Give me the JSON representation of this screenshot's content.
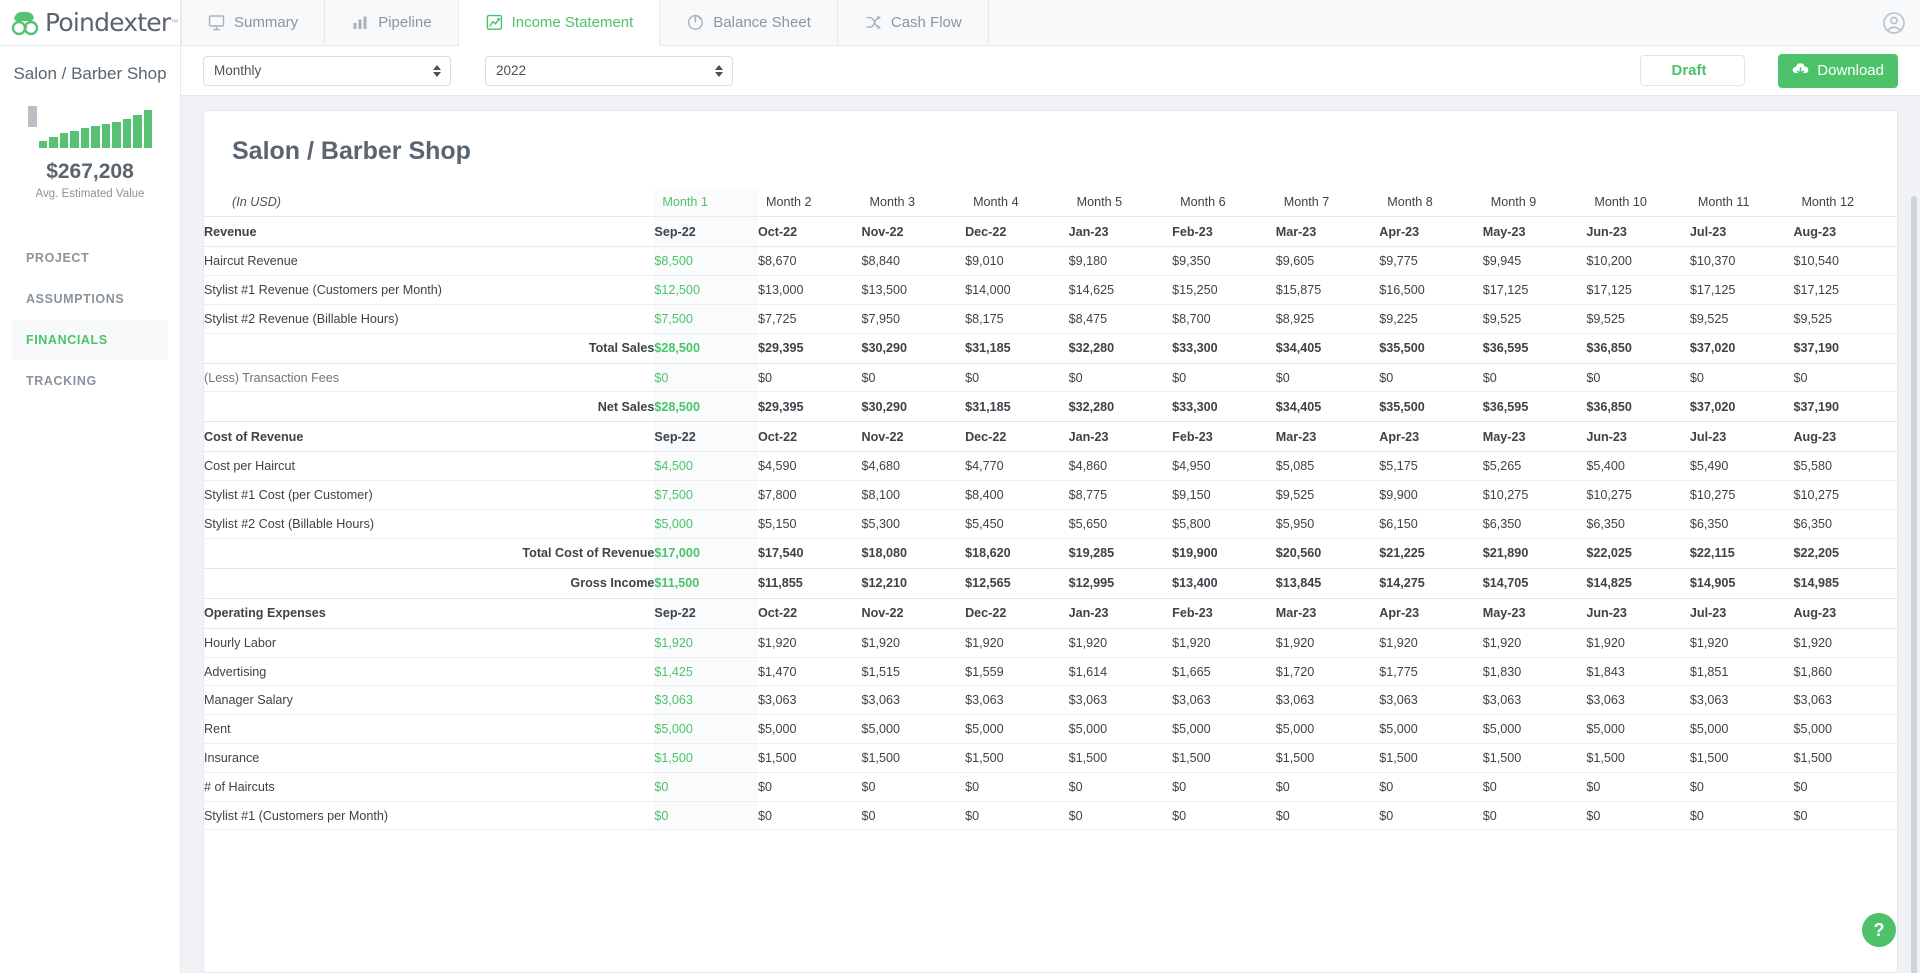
{
  "brand": {
    "name": "Poindexter",
    "tm": "™"
  },
  "sidebar": {
    "project_name": "Salon / Barber Shop",
    "value": "$267,208",
    "value_caption": "Avg. Estimated Value",
    "sparkline": [
      -18,
      6,
      10,
      13,
      15,
      17,
      19,
      21,
      23,
      25,
      29,
      33
    ],
    "items": [
      {
        "label": "PROJECT",
        "active": false
      },
      {
        "label": "ASSUMPTIONS",
        "active": false
      },
      {
        "label": "FINANCIALS",
        "active": true
      },
      {
        "label": "TRACKING",
        "active": false
      }
    ]
  },
  "tabs": [
    {
      "label": "Summary",
      "icon": "presentation-icon",
      "active": false
    },
    {
      "label": "Pipeline",
      "icon": "bar-chart-icon",
      "active": false
    },
    {
      "label": "Income Statement",
      "icon": "line-chart-icon",
      "active": true
    },
    {
      "label": "Balance Sheet",
      "icon": "pie-chart-icon",
      "active": false
    },
    {
      "label": "Cash Flow",
      "icon": "shuffle-icon",
      "active": false
    }
  ],
  "toolbar": {
    "period": "Monthly",
    "year": "2022",
    "status": "Draft",
    "download": "Download"
  },
  "report": {
    "title": "Salon / Barber Shop",
    "units_label": "(In USD)",
    "columns": [
      "Month 1",
      "Month 2",
      "Month 3",
      "Month 4",
      "Month 5",
      "Month 6",
      "Month 7",
      "Month 8",
      "Month 9",
      "Month 10",
      "Month 11",
      "Month 12"
    ],
    "dates": [
      "Sep-22",
      "Oct-22",
      "Nov-22",
      "Dec-22",
      "Jan-23",
      "Feb-23",
      "Mar-23",
      "Apr-23",
      "May-23",
      "Jun-23",
      "Jul-23",
      "Aug-23"
    ],
    "rows": [
      {
        "kind": "section",
        "label": "Revenue"
      },
      {
        "kind": "item",
        "label": "Haircut Revenue",
        "values": [
          "$8,500",
          "$8,670",
          "$8,840",
          "$9,010",
          "$9,180",
          "$9,350",
          "$9,605",
          "$9,775",
          "$9,945",
          "$10,200",
          "$10,370",
          "$10,540"
        ]
      },
      {
        "kind": "item",
        "label": "Stylist #1 Revenue (Customers per Month)",
        "values": [
          "$12,500",
          "$13,000",
          "$13,500",
          "$14,000",
          "$14,625",
          "$15,250",
          "$15,875",
          "$16,500",
          "$17,125",
          "$17,125",
          "$17,125",
          "$17,125"
        ]
      },
      {
        "kind": "item",
        "label": "Stylist #2 Revenue (Billable Hours)",
        "values": [
          "$7,500",
          "$7,725",
          "$7,950",
          "$8,175",
          "$8,475",
          "$8,700",
          "$8,925",
          "$9,225",
          "$9,525",
          "$9,525",
          "$9,525",
          "$9,525"
        ]
      },
      {
        "kind": "total",
        "label": "Total Sales",
        "values": [
          "$28,500",
          "$29,395",
          "$30,290",
          "$31,185",
          "$32,280",
          "$33,300",
          "$34,405",
          "$35,500",
          "$36,595",
          "$36,850",
          "$37,020",
          "$37,190"
        ]
      },
      {
        "kind": "item",
        "muted": true,
        "label": "(Less) Transaction Fees",
        "values": [
          "$0",
          "$0",
          "$0",
          "$0",
          "$0",
          "$0",
          "$0",
          "$0",
          "$0",
          "$0",
          "$0",
          "$0"
        ]
      },
      {
        "kind": "total",
        "label": "Net Sales",
        "values": [
          "$28,500",
          "$29,395",
          "$30,290",
          "$31,185",
          "$32,280",
          "$33,300",
          "$34,405",
          "$35,500",
          "$36,595",
          "$36,850",
          "$37,020",
          "$37,190"
        ]
      },
      {
        "kind": "section",
        "label": "Cost of Revenue"
      },
      {
        "kind": "item",
        "label": "Cost per Haircut",
        "values": [
          "$4,500",
          "$4,590",
          "$4,680",
          "$4,770",
          "$4,860",
          "$4,950",
          "$5,085",
          "$5,175",
          "$5,265",
          "$5,400",
          "$5,490",
          "$5,580"
        ]
      },
      {
        "kind": "item",
        "label": "Stylist #1 Cost (per Customer)",
        "values": [
          "$7,500",
          "$7,800",
          "$8,100",
          "$8,400",
          "$8,775",
          "$9,150",
          "$9,525",
          "$9,900",
          "$10,275",
          "$10,275",
          "$10,275",
          "$10,275"
        ]
      },
      {
        "kind": "item",
        "label": "Stylist #2 Cost (Billable Hours)",
        "values": [
          "$5,000",
          "$5,150",
          "$5,300",
          "$5,450",
          "$5,650",
          "$5,800",
          "$5,950",
          "$6,150",
          "$6,350",
          "$6,350",
          "$6,350",
          "$6,350"
        ]
      },
      {
        "kind": "total",
        "label": "Total Cost of Revenue",
        "values": [
          "$17,000",
          "$17,540",
          "$18,080",
          "$18,620",
          "$19,285",
          "$19,900",
          "$20,560",
          "$21,225",
          "$21,890",
          "$22,025",
          "$22,115",
          "$22,205"
        ]
      },
      {
        "kind": "total",
        "label": "Gross Income",
        "values": [
          "$11,500",
          "$11,855",
          "$12,210",
          "$12,565",
          "$12,995",
          "$13,400",
          "$13,845",
          "$14,275",
          "$14,705",
          "$14,825",
          "$14,905",
          "$14,985"
        ]
      },
      {
        "kind": "section",
        "label": "Operating Expenses"
      },
      {
        "kind": "item",
        "label": "Hourly Labor",
        "values": [
          "$1,920",
          "$1,920",
          "$1,920",
          "$1,920",
          "$1,920",
          "$1,920",
          "$1,920",
          "$1,920",
          "$1,920",
          "$1,920",
          "$1,920",
          "$1,920"
        ]
      },
      {
        "kind": "item",
        "label": "Advertising",
        "values": [
          "$1,425",
          "$1,470",
          "$1,515",
          "$1,559",
          "$1,614",
          "$1,665",
          "$1,720",
          "$1,775",
          "$1,830",
          "$1,843",
          "$1,851",
          "$1,860"
        ]
      },
      {
        "kind": "item",
        "label": "Manager Salary",
        "values": [
          "$3,063",
          "$3,063",
          "$3,063",
          "$3,063",
          "$3,063",
          "$3,063",
          "$3,063",
          "$3,063",
          "$3,063",
          "$3,063",
          "$3,063",
          "$3,063"
        ]
      },
      {
        "kind": "item",
        "label": "Rent",
        "values": [
          "$5,000",
          "$5,000",
          "$5,000",
          "$5,000",
          "$5,000",
          "$5,000",
          "$5,000",
          "$5,000",
          "$5,000",
          "$5,000",
          "$5,000",
          "$5,000"
        ]
      },
      {
        "kind": "item",
        "label": "Insurance",
        "values": [
          "$1,500",
          "$1,500",
          "$1,500",
          "$1,500",
          "$1,500",
          "$1,500",
          "$1,500",
          "$1,500",
          "$1,500",
          "$1,500",
          "$1,500",
          "$1,500"
        ]
      },
      {
        "kind": "item",
        "label": "# of Haircuts",
        "values": [
          "$0",
          "$0",
          "$0",
          "$0",
          "$0",
          "$0",
          "$0",
          "$0",
          "$0",
          "$0",
          "$0",
          "$0"
        ]
      },
      {
        "kind": "item",
        "label": "Stylist #1 (Customers per Month)",
        "values": [
          "$0",
          "$0",
          "$0",
          "$0",
          "$0",
          "$0",
          "$0",
          "$0",
          "$0",
          "$0",
          "$0",
          "$0"
        ]
      }
    ]
  },
  "help": {
    "label": "?"
  },
  "colors": {
    "accent": "#4cc36a",
    "muted": "#8a949d",
    "text": "#3c4349"
  }
}
